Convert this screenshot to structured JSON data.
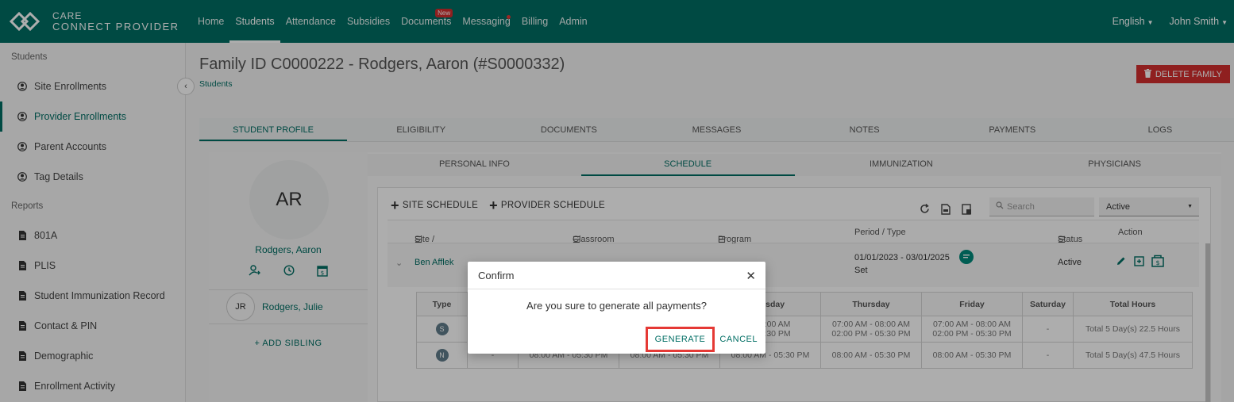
{
  "brand": {
    "line1": "CARE",
    "line2": "CONNECT PROVIDER"
  },
  "nav": {
    "items": [
      {
        "label": "Home"
      },
      {
        "label": "Students"
      },
      {
        "label": "Attendance"
      },
      {
        "label": "Subsidies"
      },
      {
        "label": "Documents",
        "badge": "New"
      },
      {
        "label": "Messaging"
      },
      {
        "label": "Billing"
      },
      {
        "label": "Admin"
      }
    ],
    "language": "English",
    "user": "John Smith"
  },
  "sidebar": {
    "section_students": "Students",
    "students_items": [
      {
        "label": "Site Enrollments"
      },
      {
        "label": "Provider Enrollments"
      },
      {
        "label": "Parent Accounts"
      },
      {
        "label": "Tag Details"
      }
    ],
    "section_reports": "Reports",
    "reports_items": [
      {
        "label": "801A"
      },
      {
        "label": "PLIS"
      },
      {
        "label": "Student Immunization Record"
      },
      {
        "label": "Contact & PIN"
      },
      {
        "label": "Demographic"
      },
      {
        "label": "Enrollment Activity"
      }
    ]
  },
  "page": {
    "title": "Family ID C0000222 - Rodgers, Aaron (#S0000332)",
    "breadcrumb": "Students",
    "delete_label": "DELETE FAMILY"
  },
  "tabs": [
    "STUDENT PROFILE",
    "ELIGIBILITY",
    "DOCUMENTS",
    "MESSAGES",
    "NOTES",
    "PAYMENTS",
    "LOGS"
  ],
  "profile": {
    "initials": "AR",
    "name": "Rodgers, Aaron",
    "sibling_initials": "JR",
    "sibling_name": "Rodgers, Julie",
    "add_sibling": "+   ADD SIBLING"
  },
  "subtabs": [
    "PERSONAL INFO",
    "SCHEDULE",
    "IMMUNIZATION",
    "PHYSICIANS"
  ],
  "schedule": {
    "site_schedule": "SITE SCHEDULE",
    "provider_schedule": "PROVIDER SCHEDULE",
    "search_placeholder": "Search",
    "status_filter": "Active",
    "columns": [
      "Site / Provider",
      "Classroom",
      "Program",
      "Period / Type",
      "Status",
      "Action"
    ],
    "row": {
      "provider": "Ben Afflek",
      "period": "01/01/2023 - 03/01/2025",
      "type": "Set",
      "status": "Active"
    },
    "inner_headers": [
      "Type",
      "",
      "",
      "",
      "nesday",
      "Thursday",
      "Friday",
      "Saturday",
      "Total Hours"
    ],
    "inner_rows": [
      {
        "type": "S",
        "c1": "",
        "c2": "",
        "c3": "",
        "wed": "- 08:00 AM\n- 05:30 PM",
        "thu": "07:00 AM - 08:00 AM\n02:00 PM - 05:30 PM",
        "fri": "07:00 AM - 08:00 AM\n02:00 PM - 05:30 PM",
        "sat": "-",
        "total": "Total 5 Day(s) 22.5 Hours"
      },
      {
        "type": "N",
        "c1": "-",
        "c2": "08:00 AM - 05:30 PM",
        "c3": "08:00 AM - 05:30 PM",
        "wed": "08:00 AM - 05:30 PM",
        "thu": "08:00 AM - 05:30 PM",
        "fri": "08:00 AM - 05:30 PM",
        "sat": "-",
        "total": "Total 5 Day(s) 47.5 Hours"
      }
    ]
  },
  "modal": {
    "title": "Confirm",
    "message": "Are you sure to generate all payments?",
    "generate": "GENERATE",
    "cancel": "CANCEL"
  }
}
